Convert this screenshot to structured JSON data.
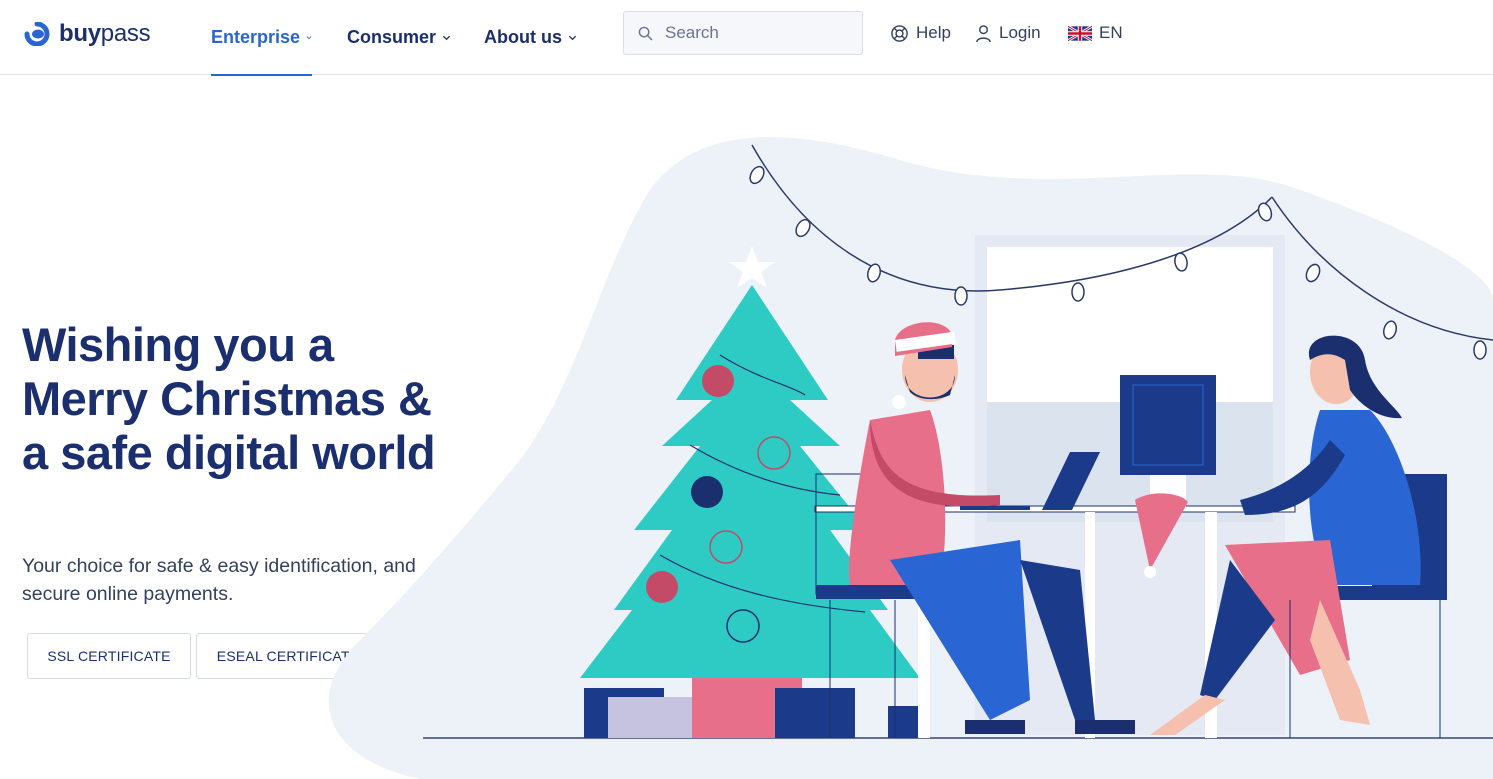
{
  "header": {
    "logo_text_bold": "buy",
    "logo_text_light": "pass",
    "nav": [
      {
        "label": "Enterprise",
        "active": true
      },
      {
        "label": "Consumer",
        "active": false
      },
      {
        "label": "About us",
        "active": false
      }
    ],
    "search": {
      "placeholder": "Search",
      "value": ""
    },
    "help_label": "Help",
    "login_label": "Login",
    "language_label": "EN"
  },
  "hero": {
    "title": "Wishing you a Merry Christmas & a safe digital world",
    "subtitle": "Your choice for safe & easy identification, and secure online payments.",
    "buttons": [
      {
        "label": "SSL CERTIFICATE"
      },
      {
        "label": "ESEAL CERTIFICATE"
      }
    ]
  },
  "colors": {
    "brand_navy": "#1b2f6e",
    "accent_blue": "#2a66d3",
    "tree_teal": "#2ecbc4",
    "santa_pink": "#e86f8a",
    "background_blob": "#edf1f8"
  },
  "icons": [
    "search-icon",
    "lifebuoy-icon",
    "user-icon",
    "uk-flag-icon",
    "chevron-down-icon"
  ]
}
